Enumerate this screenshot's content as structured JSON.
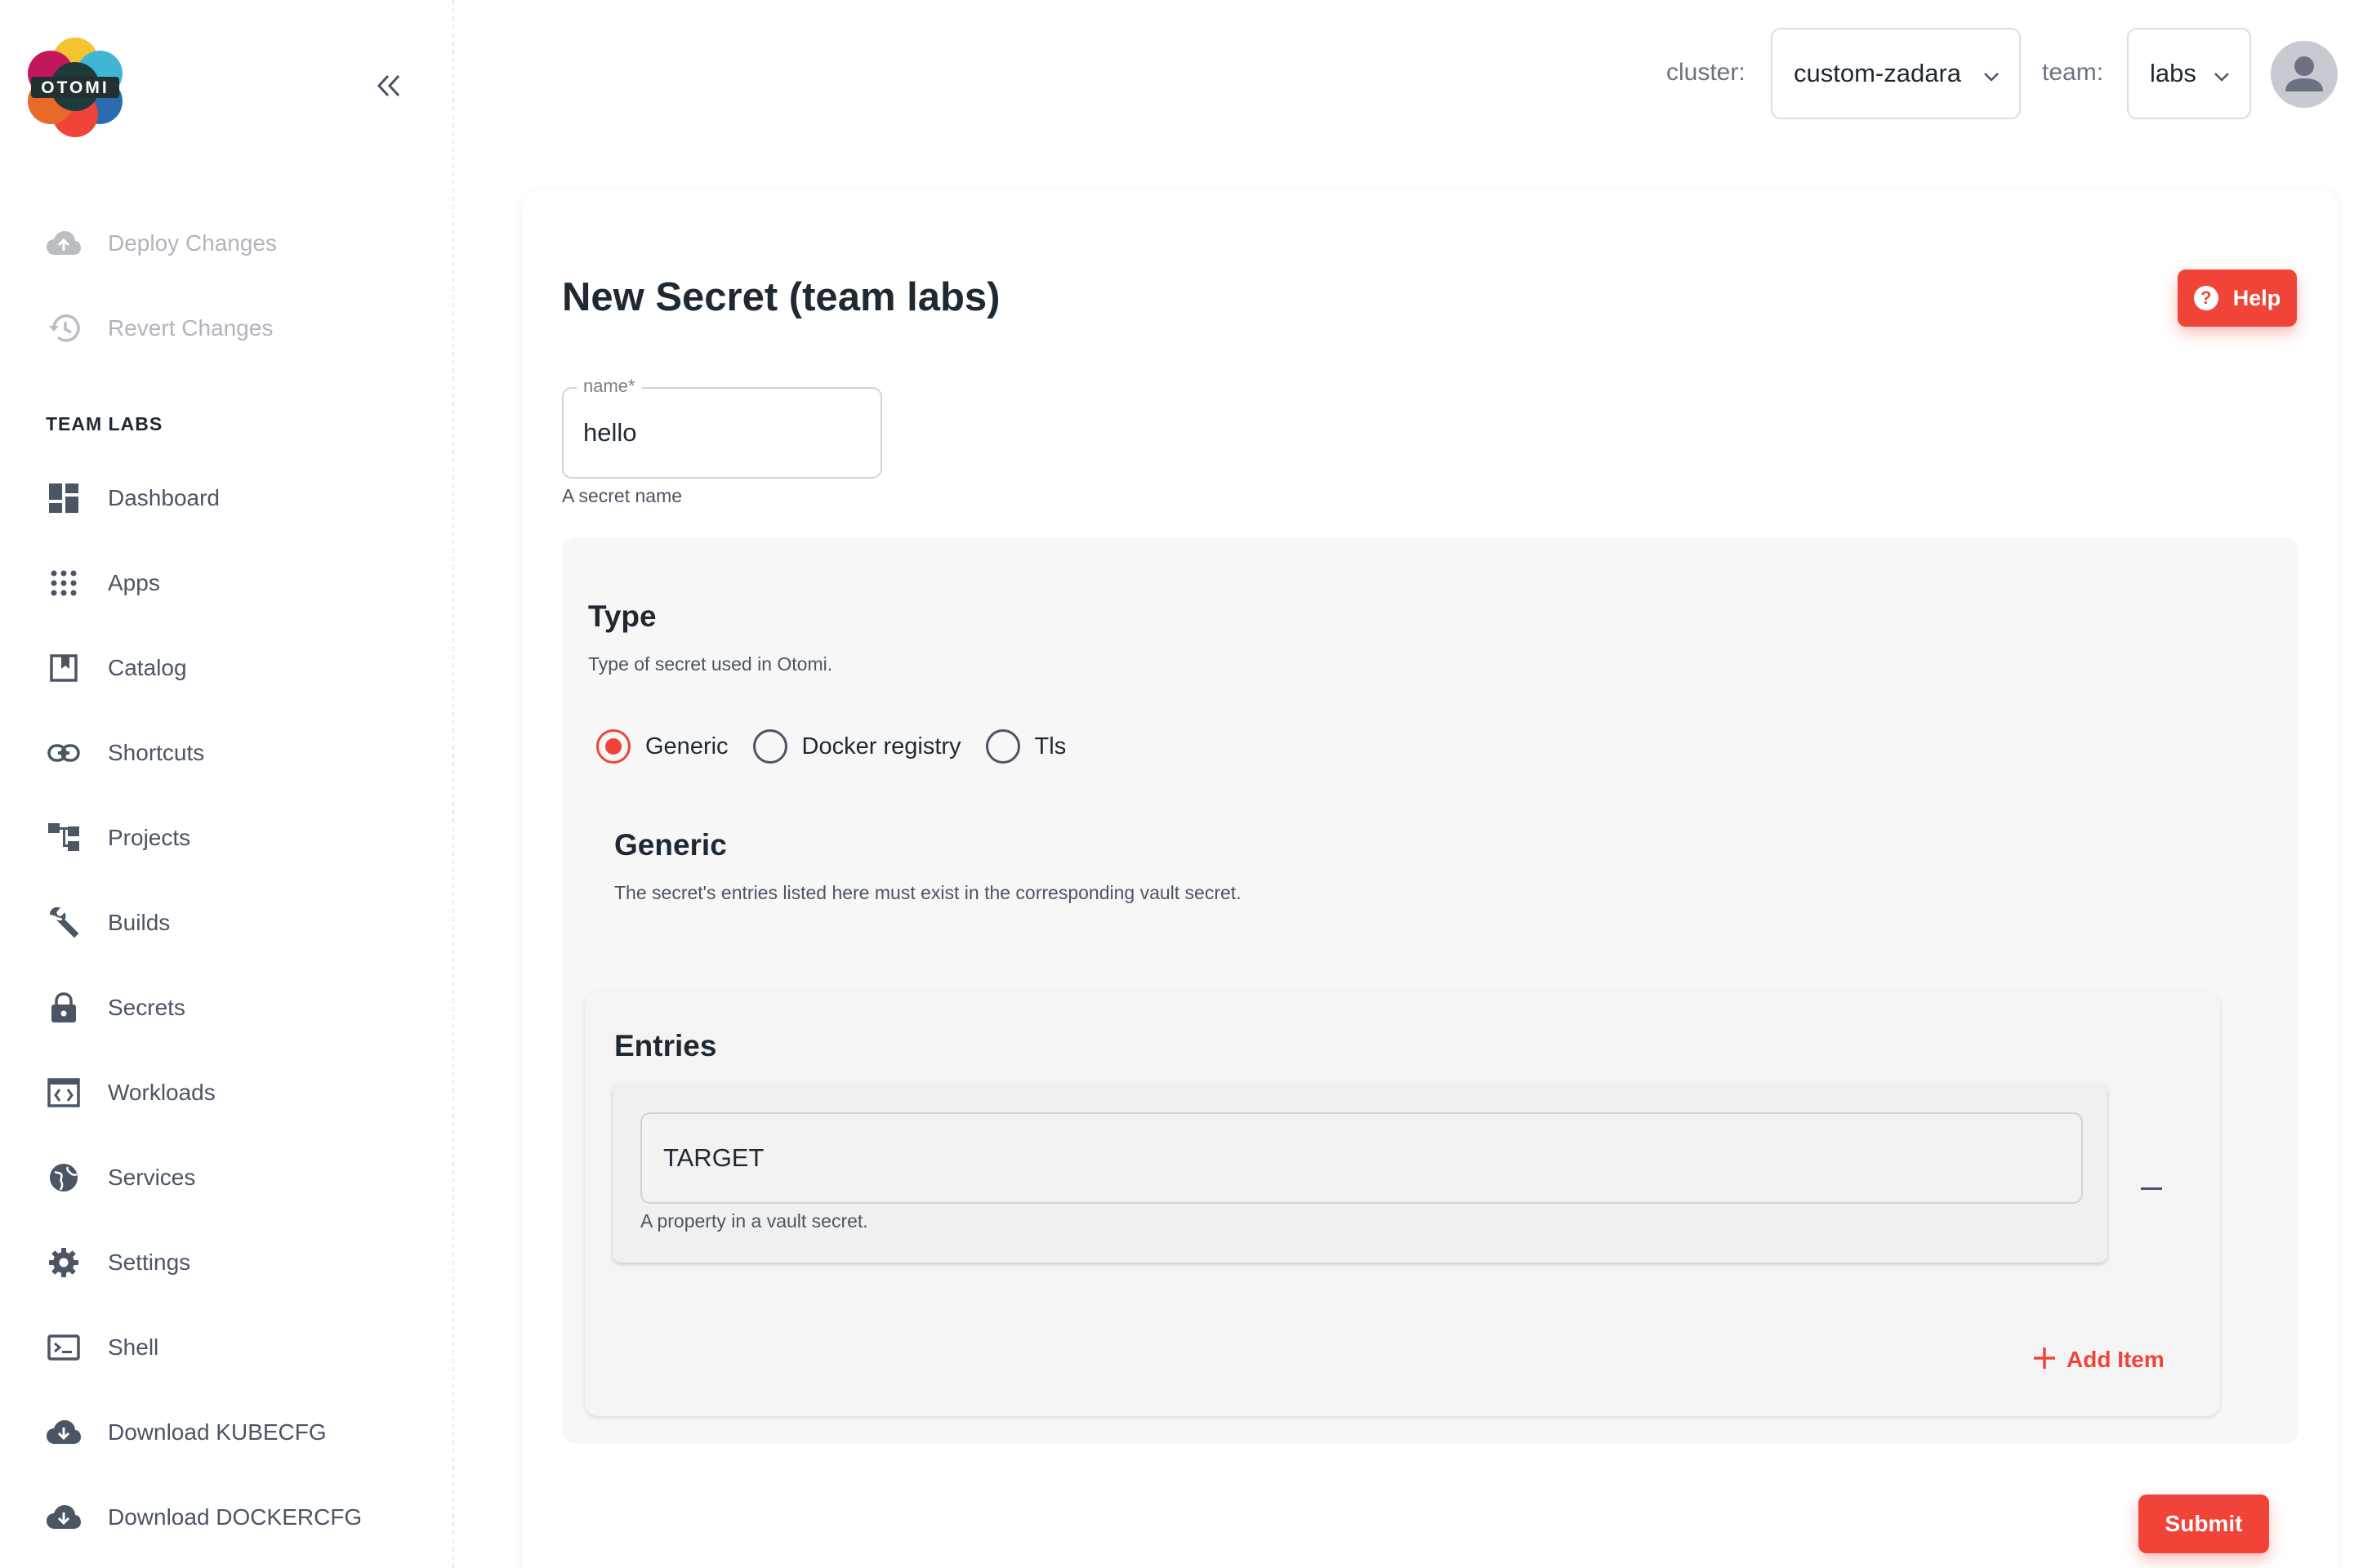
{
  "brand": {
    "logo_text": "OTOMI"
  },
  "sidebar": {
    "actions": [
      {
        "label": "Deploy Changes",
        "icon": "cloud-upload-icon"
      },
      {
        "label": "Revert Changes",
        "icon": "history-icon"
      }
    ],
    "section_title": "TEAM LABS",
    "items": [
      {
        "label": "Dashboard",
        "icon": "dashboard-icon"
      },
      {
        "label": "Apps",
        "icon": "apps-grid-icon"
      },
      {
        "label": "Catalog",
        "icon": "catalog-icon"
      },
      {
        "label": "Shortcuts",
        "icon": "link-icon"
      },
      {
        "label": "Projects",
        "icon": "projects-icon"
      },
      {
        "label": "Builds",
        "icon": "wrench-icon"
      },
      {
        "label": "Secrets",
        "icon": "lock-icon"
      },
      {
        "label": "Workloads",
        "icon": "workloads-icon"
      },
      {
        "label": "Services",
        "icon": "services-icon"
      },
      {
        "label": "Settings",
        "icon": "gear-icon"
      },
      {
        "label": "Shell",
        "icon": "terminal-icon"
      },
      {
        "label": "Download KUBECFG",
        "icon": "cloud-download-icon"
      },
      {
        "label": "Download DOCKERCFG",
        "icon": "cloud-download-icon"
      }
    ]
  },
  "topbar": {
    "cluster_label": "cluster:",
    "cluster_value": "custom-zadara",
    "team_label": "team:",
    "team_value": "labs"
  },
  "form": {
    "title": "New Secret (team labs)",
    "help_label": "Help",
    "name_field": {
      "label": "name",
      "required_mark": "*",
      "value": "hello",
      "helper": "A secret name"
    },
    "type_section": {
      "title": "Type",
      "description": "Type of secret used in Otomi.",
      "options": [
        "Generic",
        "Docker registry",
        "Tls"
      ],
      "selected": "Generic"
    },
    "generic_section": {
      "title": "Generic",
      "description": "The secret's entries listed here must exist in the corresponding vault secret."
    },
    "entries": {
      "title": "Entries",
      "items": [
        {
          "value": "TARGET",
          "helper": "A property in a vault secret."
        }
      ],
      "add_label": "Add Item"
    },
    "submit_label": "Submit"
  },
  "colors": {
    "accent": "#f04438",
    "text": "#1f2933",
    "muted": "#6b7280"
  }
}
